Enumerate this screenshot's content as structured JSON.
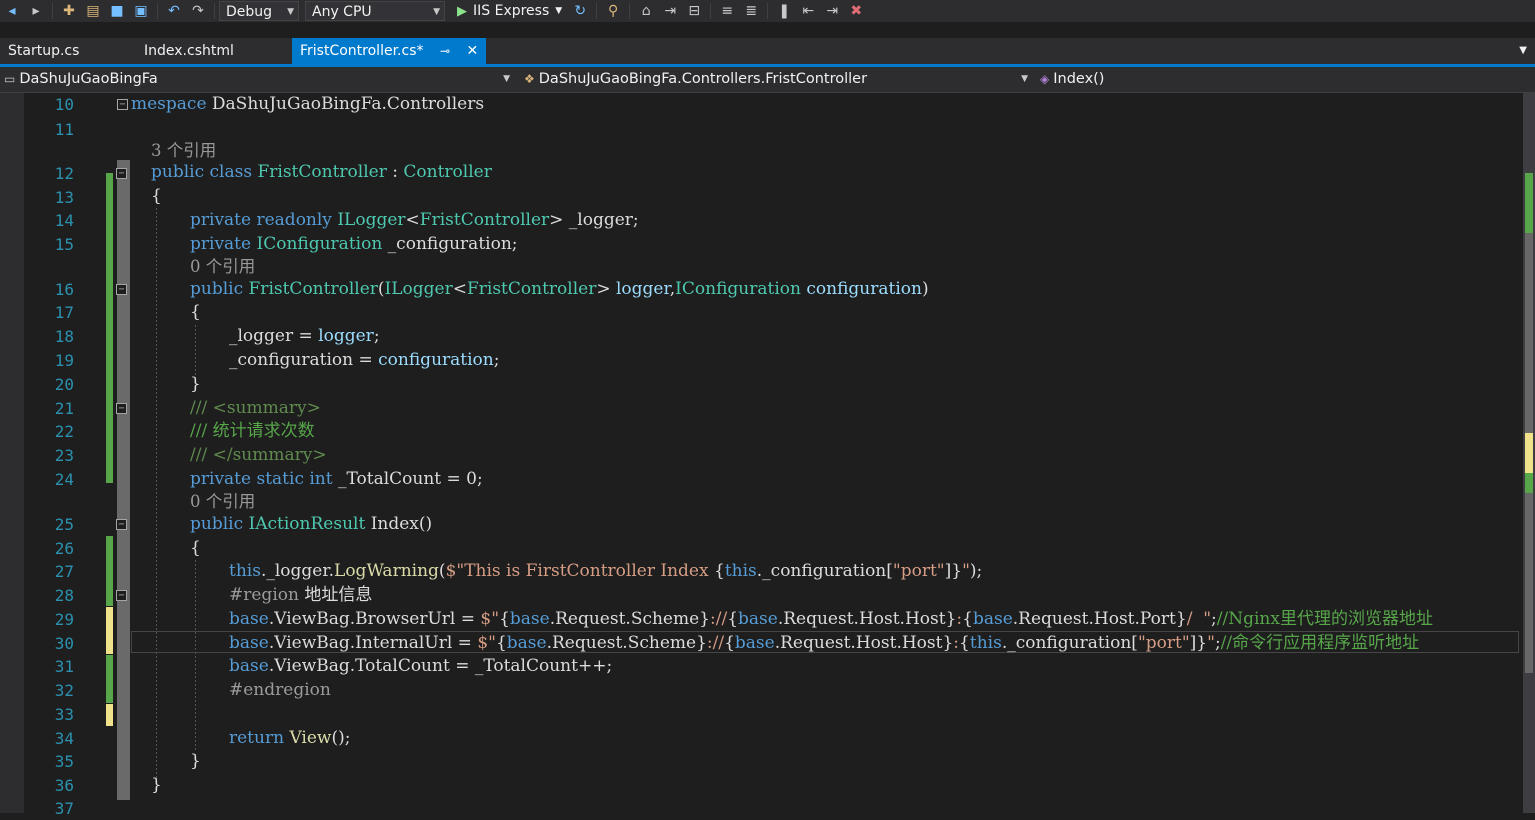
{
  "toolbar": {
    "config": "Debug",
    "platform": "Any CPU",
    "run_target": "IIS Express",
    "icons": [
      "back-icon",
      "forward-icon",
      "new-item-icon",
      "open-icon",
      "save-icon",
      "save-all-icon",
      "undo-icon",
      "redo-icon",
      "play-icon",
      "refresh-icon",
      "browser-link-icon",
      "home-icon",
      "step-icon",
      "comment-icon",
      "uncomment-icon",
      "bookmark-icon",
      "prev-bookmark-icon",
      "next-bookmark-icon",
      "clear-bookmark-icon"
    ]
  },
  "tabs": [
    {
      "label": "Startup.cs"
    },
    {
      "label": "Index.cshtml"
    },
    {
      "label": "FristController.cs*",
      "active": true
    }
  ],
  "nav": {
    "project": "DaShuJuGaoBingFa",
    "type": "DaShuJuGaoBingFa.Controllers.FristController",
    "member": "Index()"
  },
  "editor": {
    "line_numbers": [
      "10",
      "11",
      "12",
      "13",
      "14",
      "15",
      "16",
      "17",
      "18",
      "19",
      "20",
      "21",
      "22",
      "23",
      "24",
      "25",
      "26",
      "27",
      "28",
      "29",
      "30",
      "31",
      "32",
      "33",
      "34",
      "35",
      "36",
      "37"
    ],
    "lens_refs": {
      "class": "3 个引用",
      "ctor": "0 个引用",
      "index": "0 个引用"
    },
    "colors": {
      "keyword": "#569cd6",
      "type": "#4ec9b0",
      "string": "#d69d85",
      "comment": "#57a64a",
      "line_number": "#2b91af"
    }
  }
}
